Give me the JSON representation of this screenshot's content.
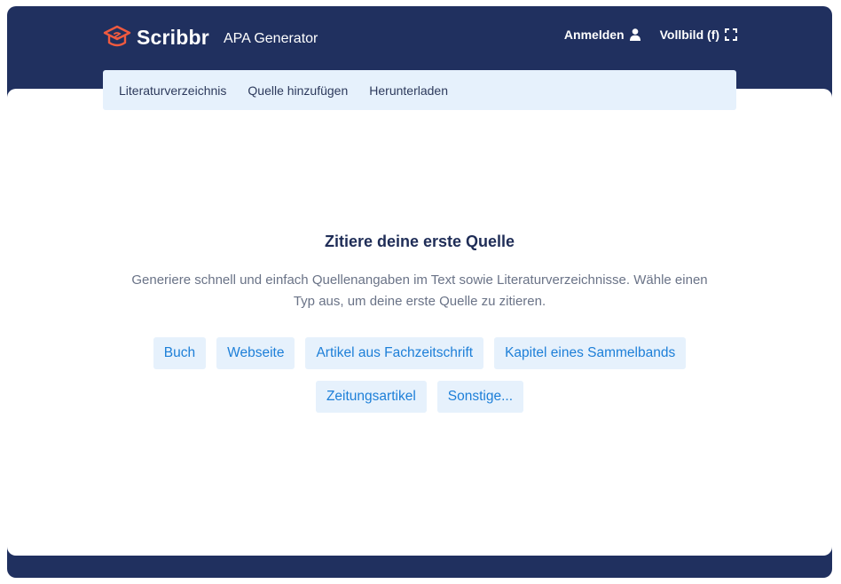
{
  "header": {
    "brand": "Scribbr",
    "product": "APA Generator",
    "login_label": "Anmelden",
    "fullscreen_label": "Vollbild (f)"
  },
  "tabs": [
    {
      "label": "Literaturverzeichnis"
    },
    {
      "label": "Quelle hinzufügen"
    },
    {
      "label": "Herunterladen"
    }
  ],
  "main": {
    "title": "Zitiere deine erste Quelle",
    "description": "Generiere schnell und einfach Quellenangaben im Text sowie Literaturverzeichnisse. Wähle einen Typ aus, um deine erste Quelle zu zitieren.",
    "source_types": [
      {
        "label": "Buch"
      },
      {
        "label": "Webseite"
      },
      {
        "label": "Artikel aus Fachzeitschrift"
      },
      {
        "label": "Kapitel eines Sammelbands"
      },
      {
        "label": "Zeitungsartikel"
      },
      {
        "label": "Sonstige..."
      }
    ]
  },
  "colors": {
    "frame": "#20305f",
    "accent_logo": "#f05a3f",
    "button_bg": "#e6f1fc",
    "button_text": "#1d7fd8",
    "title": "#1f2d57"
  }
}
